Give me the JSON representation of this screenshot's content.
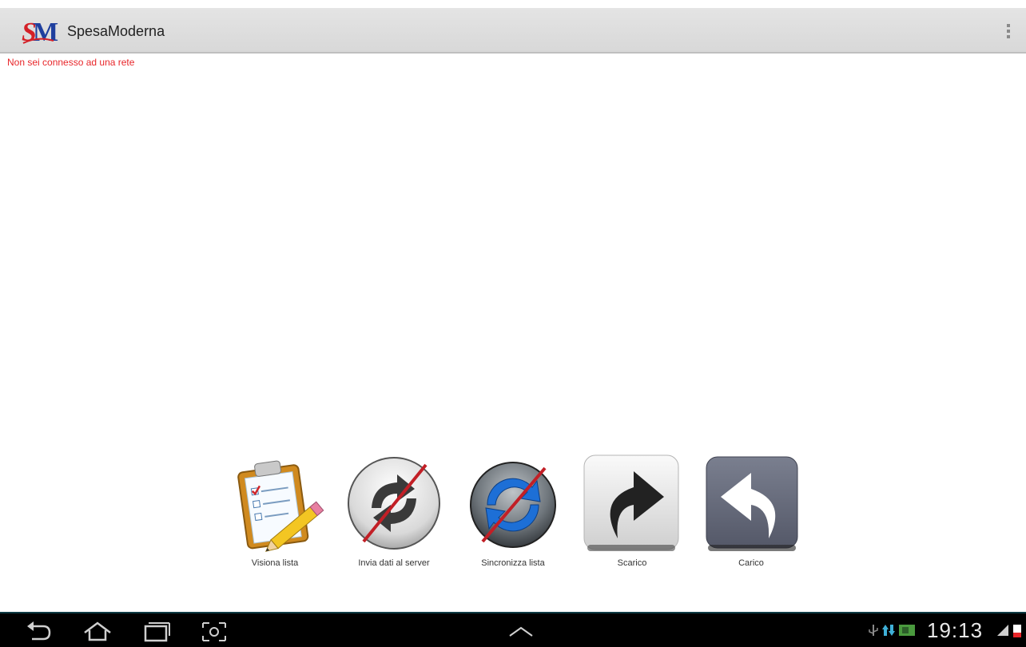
{
  "app": {
    "title": "SpesaModerna",
    "logo_text": "SM"
  },
  "status_message": "Non sei connesso ad una rete",
  "actions": [
    {
      "label": "Visiona lista",
      "icon": "clipboard-checklist-icon"
    },
    {
      "label": "Invia dati al server",
      "icon": "sync-disabled-icon"
    },
    {
      "label": "Sincronizza lista",
      "icon": "refresh-disabled-icon"
    },
    {
      "label": "Scarico",
      "icon": "arrow-forward-icon"
    },
    {
      "label": "Carico",
      "icon": "arrow-back-icon"
    }
  ],
  "system_bar": {
    "time": "19:13"
  },
  "colors": {
    "status_message": "#e8262a",
    "action_bar": "#dcdcdc",
    "nav_bar": "#000000"
  }
}
